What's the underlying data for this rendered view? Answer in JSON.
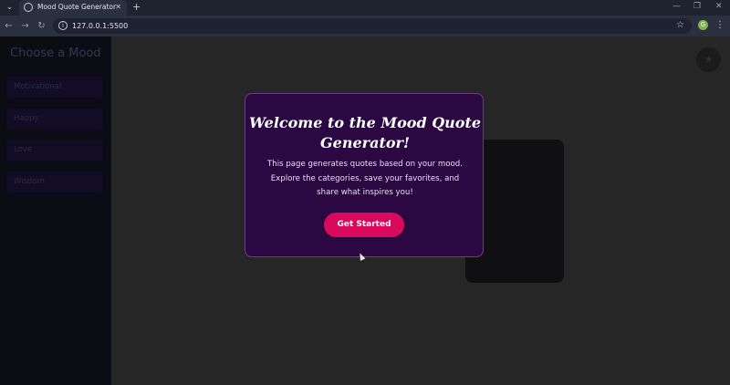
{
  "browser": {
    "tab_title": "Mood Quote Generator",
    "url": "127.0.0.1:5500",
    "profile_initial": "G"
  },
  "sidebar": {
    "title": "Choose a Mood",
    "moods": [
      "Motivational",
      "Happy",
      "Love",
      "Wisdom"
    ]
  },
  "modal": {
    "title": "Welcome to the Mood Quote Generator!",
    "text": "This page generates quotes based on your mood. Explore the categories, save your favorites, and share what inspires you!",
    "button_label": "Get Started"
  },
  "colors": {
    "modal_bg": "#2b0841",
    "button": "#d90a5c",
    "sidebar_bg": "#0c0c14"
  }
}
